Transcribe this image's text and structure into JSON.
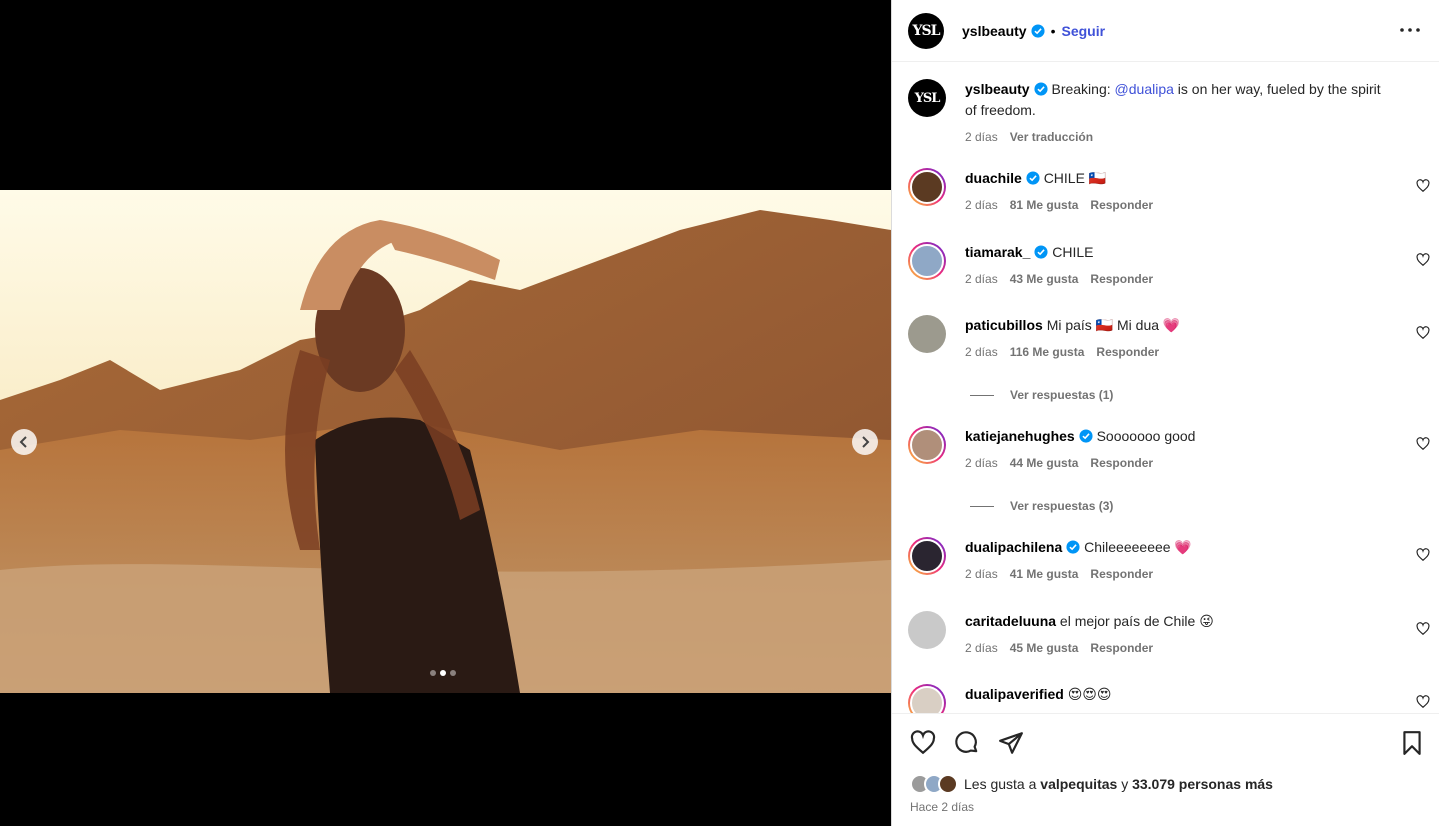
{
  "post": {
    "username": "yslbeauty",
    "follow_label": "Seguir",
    "separator": "•",
    "avatar_text": "YSL",
    "caption": {
      "username": "yslbeauty",
      "text_before": "Breaking: ",
      "mention": "@dualipa",
      "text_after": " is on her way, fueled by the spirit of freedom.",
      "time": "2 días",
      "translate_label": "Ver traducción"
    }
  },
  "media": {
    "slide_count": 3,
    "active_slide": 2
  },
  "comments": [
    {
      "username": "duachile",
      "verified": true,
      "text": "CHILE 🇨🇱",
      "time": "2 días",
      "likes": "81 Me gusta",
      "reply": "Responder",
      "avatar_color": "#5b3a22",
      "ring": true
    },
    {
      "username": "tiamarak_",
      "verified": true,
      "text": "CHILE",
      "time": "2 días",
      "likes": "43 Me gusta",
      "reply": "Responder",
      "avatar_color": "#8fa8c6",
      "ring": true
    },
    {
      "username": "paticubillos",
      "verified": false,
      "text": "Mi país 🇨🇱 Mi dua 💗",
      "time": "2 días",
      "likes": "116 Me gusta",
      "reply": "Responder",
      "avatar_color": "#9c9a8e",
      "ring": false,
      "replies": "Ver respuestas (1)"
    },
    {
      "username": "katiejanehughes",
      "verified": true,
      "text": "Sooooooo good",
      "time": "2 días",
      "likes": "44 Me gusta",
      "reply": "Responder",
      "avatar_color": "#b08f7a",
      "ring": true,
      "replies": "Ver respuestas (3)"
    },
    {
      "username": "dualipachilena",
      "verified": true,
      "text": "Chileeeeeeee 💗",
      "time": "2 días",
      "likes": "41 Me gusta",
      "reply": "Responder",
      "avatar_color": "#2a2530",
      "ring": true
    },
    {
      "username": "caritadeluuna",
      "verified": false,
      "text": "el mejor país de Chile 😜",
      "time": "2 días",
      "likes": "45 Me gusta",
      "reply": "Responder",
      "avatar_color": "#c9c9c9",
      "ring": false
    },
    {
      "username": "dualipaverified",
      "verified": false,
      "text": "😍😍😍",
      "time": "",
      "likes": "",
      "reply": "",
      "avatar_color": "#d9cfc4",
      "ring": true
    }
  ],
  "footer": {
    "likes_prefix": "Les gusta a ",
    "likes_user": "valpequitas",
    "likes_mid": " y ",
    "likes_count": "33.079 personas más",
    "posted": "Hace 2 días"
  },
  "colors": {
    "link": "#3f51d8",
    "verified": "#0095f6",
    "muted": "#737373"
  }
}
